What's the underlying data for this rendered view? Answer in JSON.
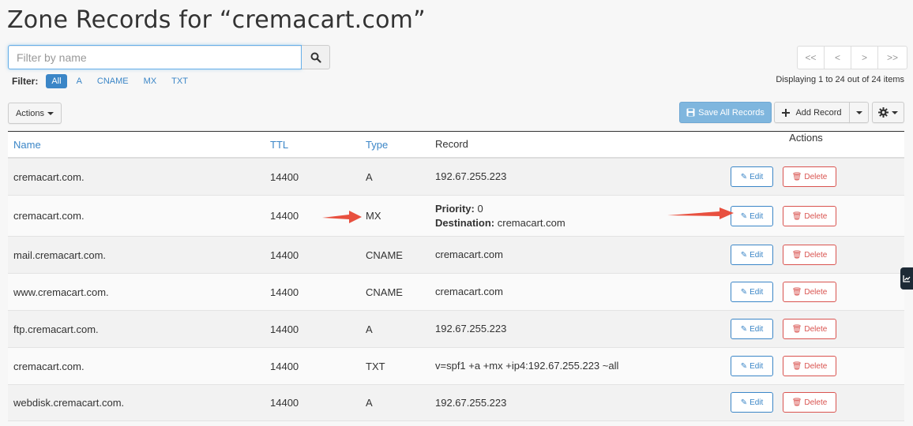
{
  "title": "Zone Records for “cremacart.com”",
  "search": {
    "placeholder": "Filter by name",
    "value": ""
  },
  "filter": {
    "label": "Filter:",
    "options": [
      "All",
      "A",
      "CNAME",
      "MX",
      "TXT"
    ],
    "active": "All"
  },
  "pager": {
    "first": "<<",
    "prev": "<",
    "next": ">",
    "last": ">>"
  },
  "display_count": "Displaying 1 to 24 out of 24 items",
  "toolbar": {
    "actions_label": "Actions",
    "save_label": "Save All Records",
    "add_label": "Add Record"
  },
  "columns": {
    "name": "Name",
    "ttl": "TTL",
    "type": "Type",
    "record": "Record",
    "actions": "Actions"
  },
  "action_labels": {
    "edit": "Edit",
    "delete": "Delete"
  },
  "rows": [
    {
      "name": "cremacart.com.",
      "ttl": "14400",
      "type": "A",
      "record": "192.67.255.223"
    },
    {
      "name": "cremacart.com.",
      "ttl": "14400",
      "type": "MX",
      "record_priority_label": "Priority:",
      "record_priority": "0",
      "record_dest_label": "Destination:",
      "record_dest": "cremacart.com"
    },
    {
      "name": "mail.cremacart.com.",
      "ttl": "14400",
      "type": "CNAME",
      "record": "cremacart.com"
    },
    {
      "name": "www.cremacart.com.",
      "ttl": "14400",
      "type": "CNAME",
      "record": "cremacart.com"
    },
    {
      "name": "ftp.cremacart.com.",
      "ttl": "14400",
      "type": "A",
      "record": "192.67.255.223"
    },
    {
      "name": "cremacart.com.",
      "ttl": "14400",
      "type": "TXT",
      "record": "v=spf1 +a +mx +ip4:192.67.255.223 ~all"
    },
    {
      "name": "webdisk.cremacart.com.",
      "ttl": "14400",
      "type": "A",
      "record": "192.67.255.223"
    }
  ],
  "colors": {
    "accent": "#3b86c7",
    "danger": "#d9534f",
    "annotation_arrow": "#e8503f"
  }
}
